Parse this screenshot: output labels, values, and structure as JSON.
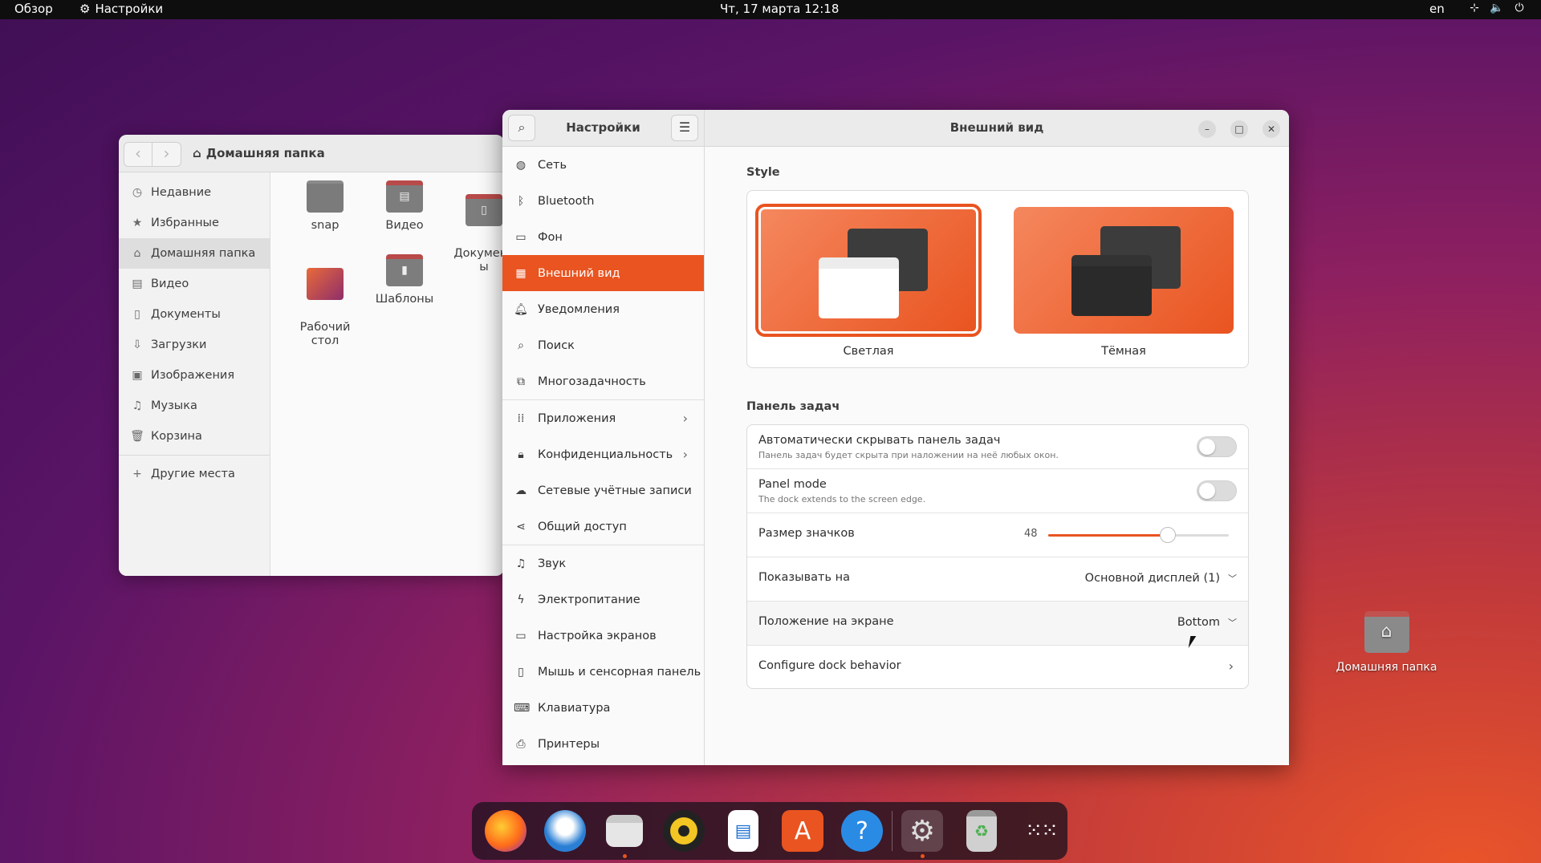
{
  "topbar": {
    "overview": "Обзор",
    "app_name": "Настройки",
    "clock": "Чт, 17 марта  12:18",
    "lang": "en",
    "tray_icons": [
      "network-icon",
      "volume-icon",
      "power-icon"
    ]
  },
  "files": {
    "path": "Домашняя папка",
    "sidebar": [
      {
        "label": "Недавние",
        "icon": "clock-icon"
      },
      {
        "label": "Избранные",
        "icon": "star-icon"
      },
      {
        "label": "Домашняя папка",
        "icon": "home-icon",
        "active": true
      },
      {
        "label": "Видео",
        "icon": "video-icon"
      },
      {
        "label": "Документы",
        "icon": "document-icon"
      },
      {
        "label": "Загрузки",
        "icon": "download-icon"
      },
      {
        "label": "Изображения",
        "icon": "image-icon"
      },
      {
        "label": "Музыка",
        "icon": "music-icon"
      },
      {
        "label": "Корзина",
        "icon": "trash-icon"
      },
      {
        "label": "Другие места",
        "icon": "plus-icon"
      }
    ],
    "folders": [
      {
        "label": "snap"
      },
      {
        "label": "Видео"
      },
      {
        "label": "Документ\nы"
      },
      {
        "label": "Рабочий\nстол"
      },
      {
        "label": "Шаблоны"
      }
    ]
  },
  "settings": {
    "sidebar_title": "Настройки",
    "main_title": "Внешний вид",
    "nav": [
      {
        "label": "Сеть",
        "icon": "network-icon"
      },
      {
        "label": "Bluetooth",
        "icon": "bluetooth-icon"
      },
      {
        "label": "Фон",
        "icon": "background-icon"
      },
      {
        "label": "Внешний вид",
        "icon": "appearance-icon",
        "active": true
      },
      {
        "label": "Уведомления",
        "icon": "bell-icon"
      },
      {
        "label": "Поиск",
        "icon": "search-icon"
      },
      {
        "label": "Многозадачность",
        "icon": "multitasking-icon"
      },
      {
        "label": "Приложения",
        "icon": "apps-icon",
        "chevron": true
      },
      {
        "label": "Конфиденциальность",
        "icon": "lock-icon",
        "chevron": true
      },
      {
        "label": "Сетевые учётные записи",
        "icon": "cloud-icon"
      },
      {
        "label": "Общий доступ",
        "icon": "share-icon"
      },
      {
        "label": "Звук",
        "icon": "music-note-icon"
      },
      {
        "label": "Электропитание",
        "icon": "power-icon"
      },
      {
        "label": "Настройка экранов",
        "icon": "display-icon"
      },
      {
        "label": "Мышь и сенсорная панель",
        "icon": "mouse-icon"
      },
      {
        "label": "Клавиатура",
        "icon": "keyboard-icon"
      },
      {
        "label": "Принтеры",
        "icon": "printer-icon"
      }
    ],
    "style": {
      "label": "Style",
      "light_label": "Светлая",
      "dark_label": "Тёмная",
      "selected": "light"
    },
    "dock": {
      "label": "Панель задач",
      "autohide_title": "Автоматически скрывать панель задач",
      "autohide_sub": "Панель задач будет скрыта при наложении на неё любых окон.",
      "autohide_on": false,
      "panel_title": "Panel mode",
      "panel_sub": "The dock extends to the screen edge.",
      "panel_on": false,
      "iconsize_title": "Размер значков",
      "iconsize_value": "48",
      "iconsize_fraction": 0.66,
      "show_on_title": "Показывать на",
      "show_on_value": "Основной дисплей (1)",
      "position_title": "Положение на экране",
      "position_value": "Bottom",
      "configure_title": "Configure dock behavior"
    }
  },
  "desktop": {
    "home_label": "Домашняя папка"
  },
  "dock": {
    "apps": [
      "firefox-icon",
      "thunderbird-icon",
      "files-icon",
      "rhythmbox-icon",
      "writer-icon",
      "app-center-icon",
      "help-icon",
      "settings-icon",
      "trash-icon",
      "app-grid-icon"
    ],
    "accent": "#e95420"
  }
}
